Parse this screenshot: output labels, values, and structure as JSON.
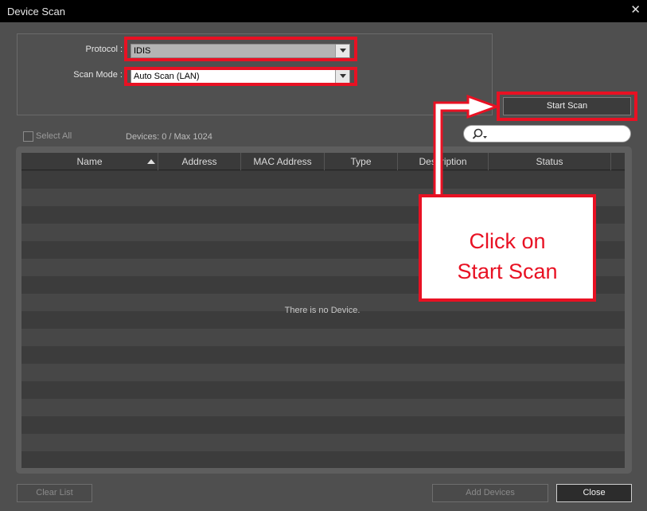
{
  "window": {
    "title": "Device Scan",
    "close_glyph": "✕"
  },
  "settings": {
    "protocol_label": "Protocol :",
    "protocol_value": "IDIS",
    "scan_mode_label": "Scan Mode :",
    "scan_mode_value": "Auto Scan (LAN)"
  },
  "toolbar": {
    "start_scan_label": "Start Scan",
    "search_placeholder": "",
    "select_all_label": "Select All",
    "devices_count": "Devices: 0 / Max 1024"
  },
  "table": {
    "columns": [
      "Name",
      "Address",
      "MAC Address",
      "Type",
      "Description",
      "Status"
    ],
    "empty_message": "There is no Device."
  },
  "footer": {
    "clear_list_label": "Clear List",
    "add_devices_label": "Add Devices",
    "close_label": "Close"
  },
  "annotation": {
    "line1": "Click on",
    "line2": "Start Scan",
    "accent_color": "#e81123"
  }
}
